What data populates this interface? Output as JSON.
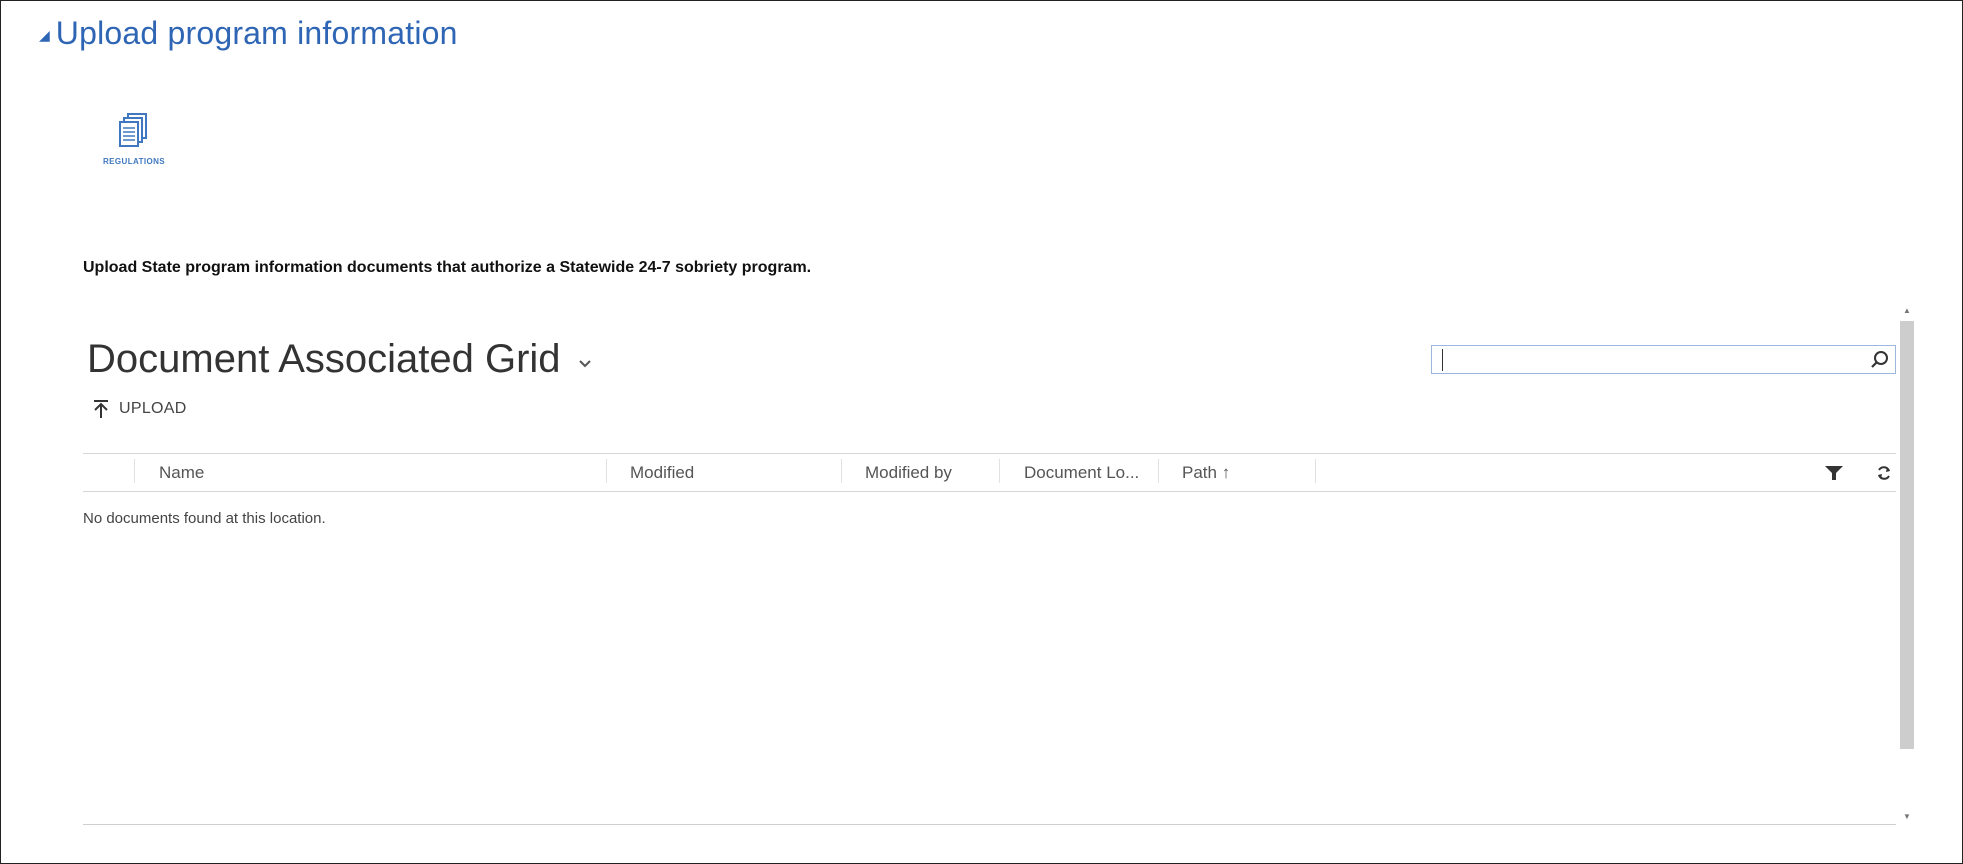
{
  "section": {
    "title": "Upload program information",
    "collapse_glyph": "◢"
  },
  "regulations": {
    "label": "REGULATIONS",
    "icon": "documents-icon"
  },
  "instructions": "Upload State program information documents that authorize a Statewide 24-7 sobriety program.",
  "grid": {
    "title": "Document Associated Grid",
    "title_chevron": "⌄",
    "search": {
      "value": "",
      "placeholder": ""
    },
    "upload_label": "UPLOAD",
    "columns": [
      {
        "label": "Name"
      },
      {
        "label": "Modified"
      },
      {
        "label": "Modified by"
      },
      {
        "label": "Document Lo..."
      },
      {
        "label": "Path ↑"
      }
    ],
    "empty_message": "No documents found at this location."
  },
  "colors": {
    "accent": "#2e65b4",
    "search_border": "#9bb7dc",
    "icon_blue": "#3f78c0"
  }
}
